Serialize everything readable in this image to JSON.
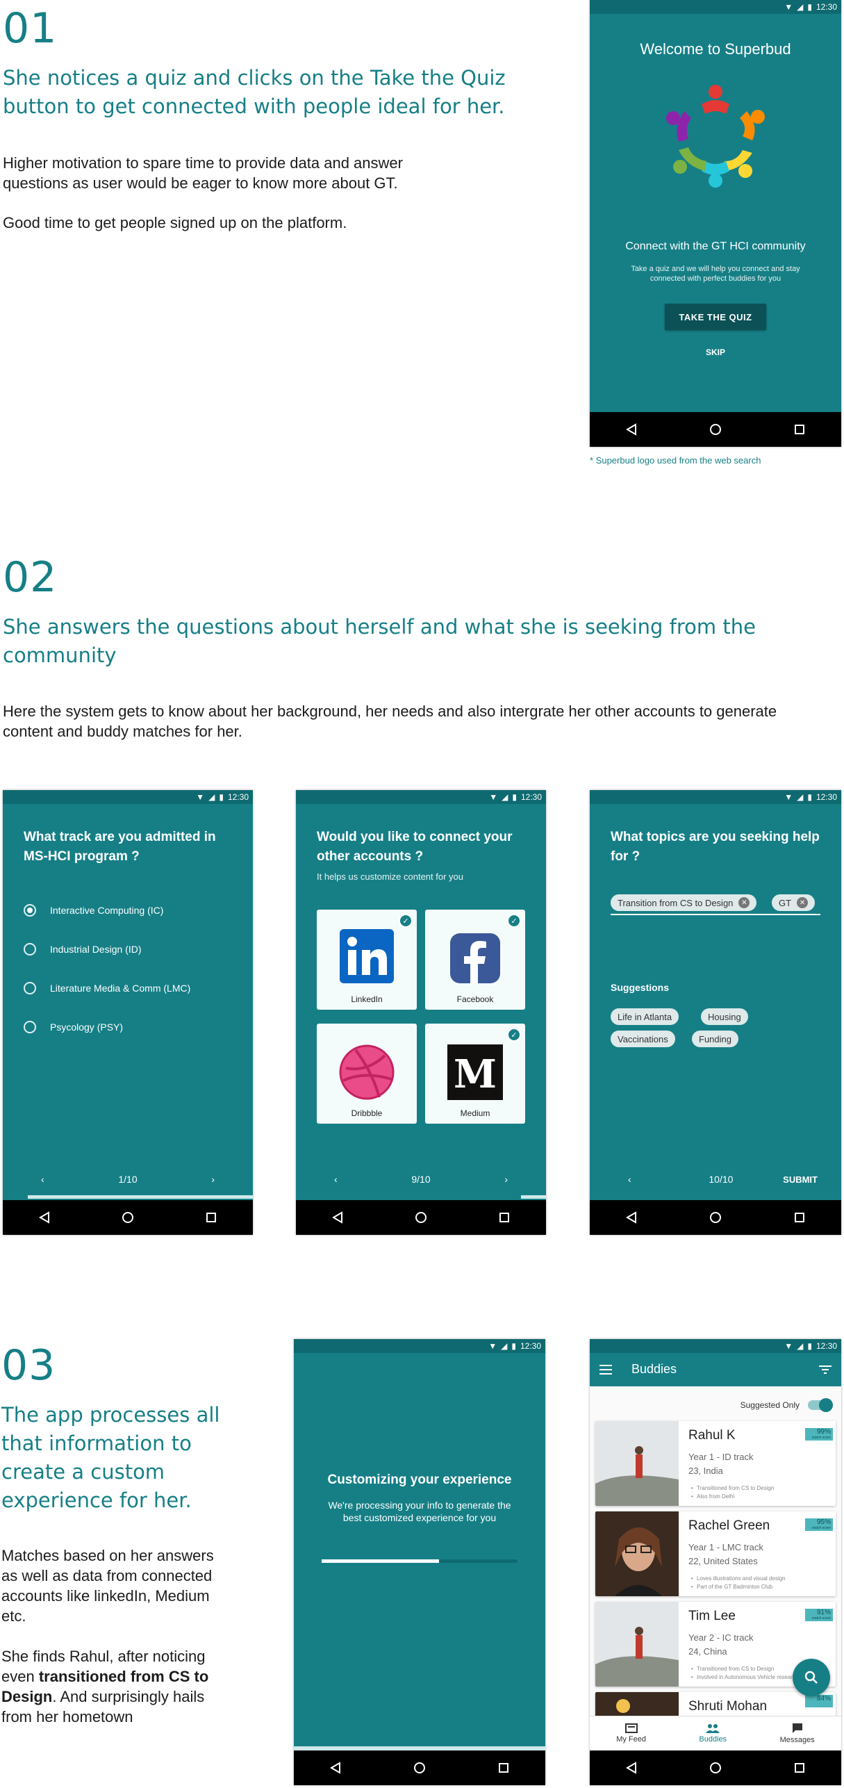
{
  "section1": {
    "number": "01",
    "heading": "She notices a quiz and clicks on the Take the Quiz button to get connected with people ideal for her.",
    "para1": "Higher motivation to spare time to provide data and answer questions as user would be eager to know more about GT.",
    "para2": "Good time to get people signed up on the platform.",
    "footnote": "* Superbud logo used from the web search"
  },
  "status_time": "12:30",
  "welcome_screen": {
    "title": "Welcome to Superbud",
    "connect_title": "Connect with the GT HCI community",
    "connect_text": "Take a quiz and we will help you connect and stay connected with perfect buddies for you",
    "quiz_button": "TAKE THE QUIZ",
    "skip": "SKIP"
  },
  "section2": {
    "number": "02",
    "heading": "She answers the questions about herself and what she is seeking from the community",
    "para": "Here the system gets to know about her background, her needs and also intergrate her other accounts to generate content and buddy matches for her."
  },
  "track_screen": {
    "question": "What track are you admitted in MS-HCI program ?",
    "options": [
      {
        "label": "Interactive Computing (IC)",
        "selected": true
      },
      {
        "label": "Industrial Design (ID)",
        "selected": false
      },
      {
        "label": "Literature Media & Comm (LMC)",
        "selected": false
      },
      {
        "label": "Psycology (PSY)",
        "selected": false
      }
    ],
    "page": "1/10",
    "progress": 0.1
  },
  "accounts_screen": {
    "question": "Would you like to connect your other accounts ?",
    "subtitle": "It helps us customize content for you",
    "accounts": [
      {
        "label": "LinkedIn",
        "checked": true
      },
      {
        "label": "Facebook",
        "checked": true
      },
      {
        "label": "Dribbble",
        "checked": false
      },
      {
        "label": "Medium",
        "checked": true
      }
    ],
    "page": "9/10",
    "progress": 0.9
  },
  "topics_screen": {
    "question": "What topics are you seeking help for ?",
    "selected_chips": [
      "Transition from CS to Design",
      "GT"
    ],
    "suggestions_label": "Suggestions",
    "suggestions": [
      "Life in Atlanta",
      "Housing",
      "Vaccinations",
      "Funding"
    ],
    "page": "10/10",
    "submit": "SUBMIT",
    "progress": 1.0
  },
  "section3": {
    "number": "03",
    "heading": "The app processes all that information to create a custom experience for her.",
    "para1": "Matches based on her answers as well as data from connected accounts like linkedIn, Medium etc.",
    "para2_a": "She finds Rahul, after noticing even ",
    "para2_bold": "transitioned from CS to Design",
    "para2_b": ". And surprisingly hails from her hometown"
  },
  "processing_screen": {
    "title": "Customizing your experience",
    "text": "We're processing your info to generate the best customized experience for you",
    "progress": 0.6
  },
  "buddies_screen": {
    "title": "Buddies",
    "suggested_only": "Suggested Only",
    "cards": [
      {
        "name": "Rahul K",
        "line1": "Year 1 - ID track",
        "line2": "23, India",
        "bullet1": "Transitioned from CS to Design",
        "bullet2": "Also from Delhi",
        "match": "99%",
        "match_sub": "match score"
      },
      {
        "name": "Rachel Green",
        "line1": "Year 1 - LMC track",
        "line2": "22, United States",
        "bullet1": "Loves illustrations and visual design",
        "bullet2": "Part of the GT Badminton Club",
        "match": "95%",
        "match_sub": "match score"
      },
      {
        "name": "Tim Lee",
        "line1": "Year 2 - IC track",
        "line2": "24, China",
        "bullet1": "Transitioned from CS to Design",
        "bullet2": "Involved in Autonomous Vehicle research",
        "match": "91%",
        "match_sub": "match score"
      },
      {
        "name": "Shruti Mohan",
        "line1": "",
        "line2": "",
        "bullet1": "",
        "bullet2": "",
        "match": "84%",
        "match_sub": ""
      }
    ],
    "nav": [
      "My Feed",
      "Buddies",
      "Messages"
    ]
  }
}
